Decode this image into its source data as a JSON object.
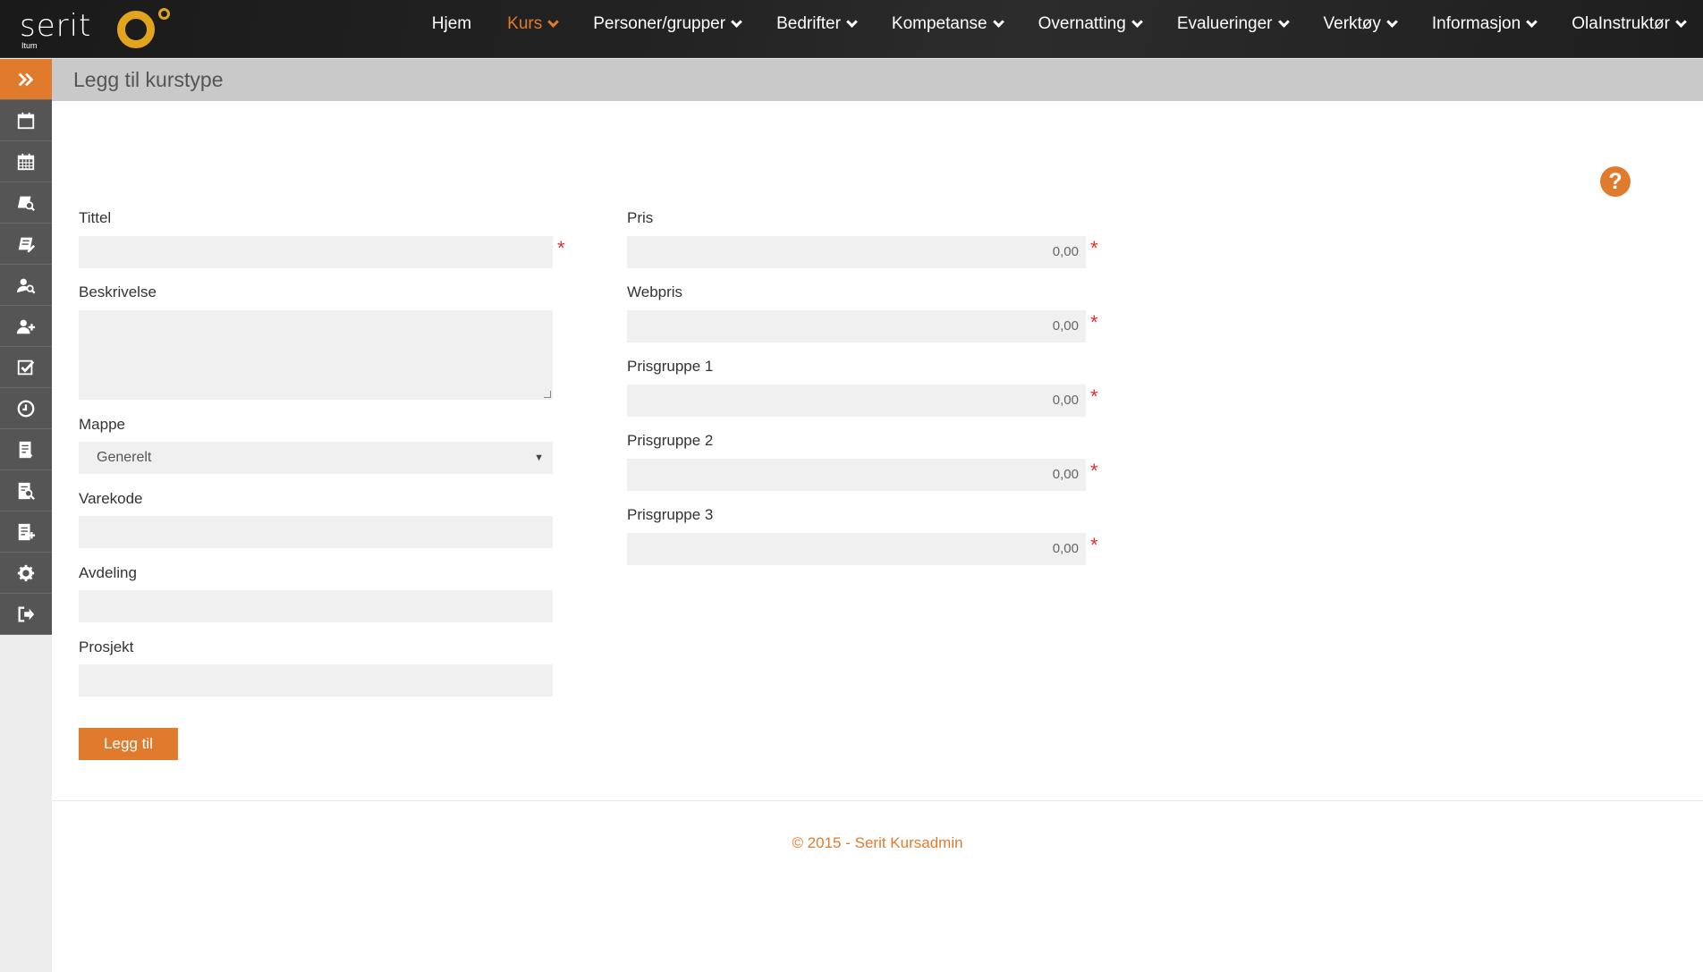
{
  "app": {
    "logo_text": "serit",
    "logo_sub": "Itum"
  },
  "nav": {
    "items": [
      {
        "label": "Hjem",
        "dropdown": false,
        "active": false
      },
      {
        "label": "Kurs",
        "dropdown": true,
        "active": true
      },
      {
        "label": "Personer/grupper",
        "dropdown": true,
        "active": false
      },
      {
        "label": "Bedrifter",
        "dropdown": true,
        "active": false
      },
      {
        "label": "Kompetanse",
        "dropdown": true,
        "active": false
      },
      {
        "label": "Overnatting",
        "dropdown": true,
        "active": false
      },
      {
        "label": "Evalueringer",
        "dropdown": true,
        "active": false
      },
      {
        "label": "Verktøy",
        "dropdown": true,
        "active": false
      },
      {
        "label": "Informasjon",
        "dropdown": true,
        "active": false
      },
      {
        "label": "OlaInstruktør",
        "dropdown": true,
        "active": false
      }
    ]
  },
  "sidebar": {
    "icons": [
      "expand-icon",
      "calendar-icon",
      "calendar-grid-icon",
      "course-search-icon",
      "course-edit-icon",
      "person-search-icon",
      "add-user-icon",
      "checkbox-icon",
      "clock-icon",
      "report-icon",
      "report-search-icon",
      "report-add-icon",
      "gear-icon",
      "logout-icon"
    ]
  },
  "page": {
    "title": "Legg til kurstype"
  },
  "form": {
    "tittel_label": "Tittel",
    "tittel_value": "",
    "beskrivelse_label": "Beskrivelse",
    "beskrivelse_value": "",
    "mappe_label": "Mappe",
    "mappe_selected": "Generelt",
    "varekode_label": "Varekode",
    "varekode_value": "",
    "avdeling_label": "Avdeling",
    "avdeling_value": "",
    "prosjekt_label": "Prosjekt",
    "prosjekt_value": "",
    "pris_label": "Pris",
    "pris_value": "0,00",
    "webpris_label": "Webpris",
    "webpris_value": "0,00",
    "prisgruppe1_label": "Prisgruppe 1",
    "prisgruppe1_value": "0,00",
    "prisgruppe2_label": "Prisgruppe 2",
    "prisgruppe2_value": "0,00",
    "prisgruppe3_label": "Prisgruppe 3",
    "prisgruppe3_value": "0,00",
    "required_marker": "*",
    "submit_label": "Legg til"
  },
  "help": {
    "symbol": "?"
  },
  "footer": {
    "text": "© 2015 - Serit Kursadmin"
  },
  "colors": {
    "accent": "#e07b2e",
    "required": "#e0302e",
    "topbar": "#1e1e1e",
    "sidebar": "#555555"
  }
}
